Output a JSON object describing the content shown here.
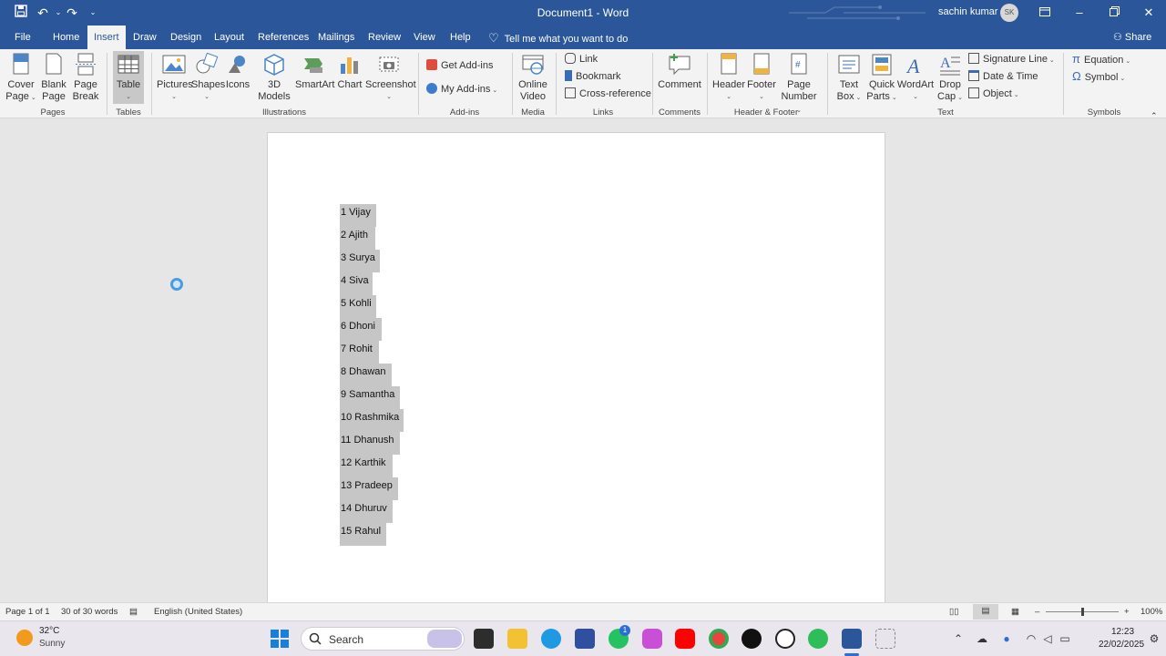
{
  "titlebar": {
    "doc_title": "Document1  -  Word",
    "user_name": "sachin kumar",
    "user_initials": "SK"
  },
  "tabs": [
    "File",
    "Home",
    "Insert",
    "Draw",
    "Design",
    "Layout",
    "References",
    "Mailings",
    "Review",
    "View",
    "Help"
  ],
  "tell_me": "Tell me what you want to do",
  "share": "Share",
  "ribbon": {
    "pages": {
      "cover_page": [
        "Cover",
        "Page"
      ],
      "blank_page": [
        "Blank",
        "Page"
      ],
      "page_break": [
        "Page",
        "Break"
      ],
      "label": "Pages"
    },
    "tables": {
      "table": "Table",
      "label": "Tables"
    },
    "illustrations": {
      "pictures": "Pictures",
      "shapes": "Shapes",
      "icons": "Icons",
      "models": [
        "3D",
        "Models"
      ],
      "smartart": "SmartArt",
      "chart": "Chart",
      "screenshot": "Screenshot",
      "label": "Illustrations"
    },
    "addins": {
      "get": "Get Add-ins",
      "my": "My Add-ins",
      "label": "Add-ins"
    },
    "media": {
      "online_video": [
        "Online",
        "Video"
      ],
      "label": "Media"
    },
    "links": {
      "link": "Link",
      "bookmark": "Bookmark",
      "cross_ref": "Cross-reference",
      "label": "Links"
    },
    "comments": {
      "comment": "Comment",
      "label": "Comments"
    },
    "header_footer": {
      "header": "Header",
      "footer": "Footer",
      "page_number": [
        "Page",
        "Number"
      ],
      "label": "Header & Footer"
    },
    "text": {
      "text_box": [
        "Text",
        "Box"
      ],
      "quick_parts": [
        "Quick",
        "Parts"
      ],
      "wordart": "WordArt",
      "drop_cap": [
        "Drop",
        "Cap"
      ],
      "signature_line": "Signature Line",
      "date_time": "Date & Time",
      "object": "Object",
      "label": "Text"
    },
    "symbols": {
      "equation": "Equation",
      "symbol": "Symbol",
      "label": "Symbols"
    }
  },
  "document_lines": [
    "1 Vijay",
    "2 Ajith",
    "3 Surya",
    "4 Siva",
    "5 Kohli",
    "6 Dhoni",
    "7 Rohit",
    "8 Dhawan",
    "9 Samantha",
    "10 Rashmika",
    "11 Dhanush",
    "12 Karthik",
    "13 Pradeep",
    "14 Dhuruv",
    "15 Rahul"
  ],
  "statusbar": {
    "page": "Page 1 of 1",
    "words": "30 of 30 words",
    "language": "English (United States)",
    "zoom": "100%"
  },
  "taskbar": {
    "temperature": "32°C",
    "weather": "Sunny",
    "search": "Search",
    "notification_count": "1",
    "time": "12:23",
    "date": "22/02/2025"
  },
  "colors": {
    "word_blue": "#2b579a",
    "selection_gray": "#c6c6c6"
  }
}
